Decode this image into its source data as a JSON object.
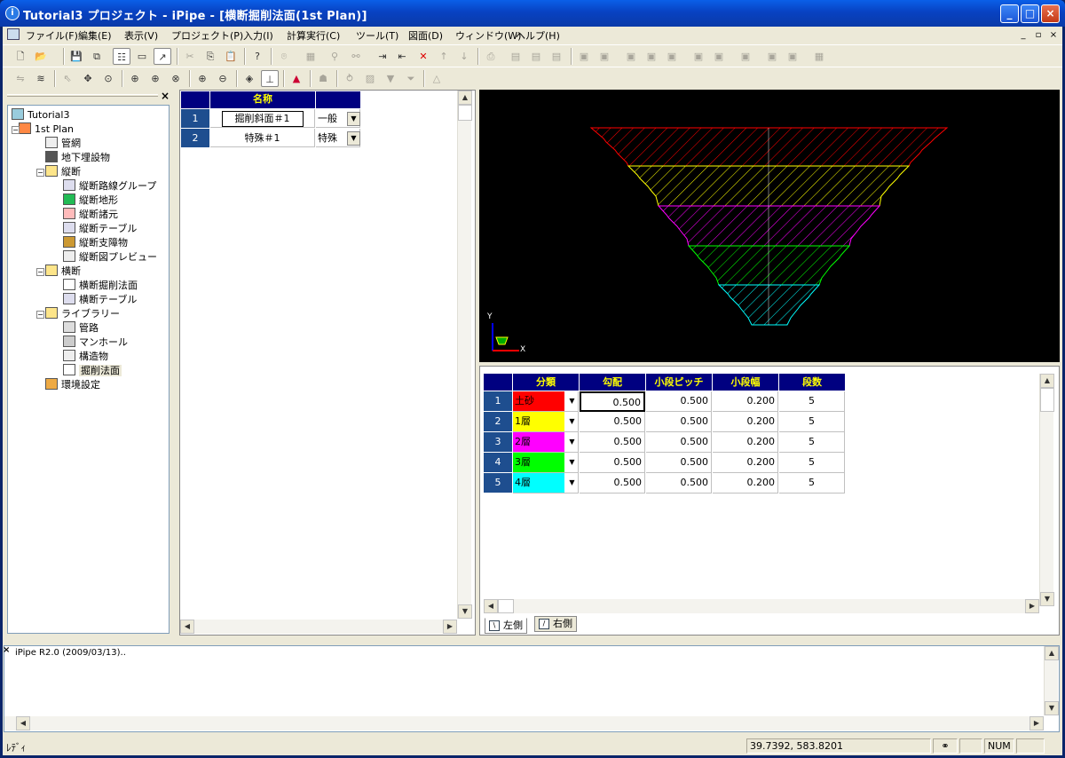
{
  "window": {
    "title": "Tutorial3 プロジェクト - iPipe - [横断掘削法面(1st Plan)]",
    "minimize": "_",
    "maximize": "□",
    "close": "×"
  },
  "menu": {
    "items": [
      "ファイル(F)",
      "編集(E)",
      "表示(V)",
      "プロジェクト(P)",
      "入力(I)",
      "計算実行(C)",
      "ツール(T)",
      "図面(D)",
      "ウィンドウ(W)",
      "ヘルプ(H)"
    ],
    "mdi_min": "_",
    "mdi_restore": "▫",
    "mdi_close": "×"
  },
  "toolbar1": [
    "new",
    "open",
    "save",
    "save-all",
    "tree",
    "frame",
    "pin",
    "cut",
    "copy",
    "paste",
    "help",
    "find",
    "delete",
    "up",
    "down"
  ],
  "tree": {
    "close": "×",
    "nodes": [
      {
        "label": "Tutorial3",
        "level": 0,
        "icon": "project-icon"
      },
      {
        "label": "1st Plan",
        "level": 1,
        "icon": "plan-icon",
        "expander": "−"
      },
      {
        "label": "管網",
        "level": 2,
        "icon": "network-icon"
      },
      {
        "label": "地下埋設物",
        "level": 2,
        "icon": "underground-icon"
      },
      {
        "label": "縦断",
        "level": 2,
        "icon": "folder-icon",
        "expander": "−"
      },
      {
        "label": "縦断路線グループ",
        "level": 3,
        "icon": "table-icon"
      },
      {
        "label": "縦断地形",
        "level": 3,
        "icon": "terrain-icon"
      },
      {
        "label": "縦断諸元",
        "level": 3,
        "icon": "spec-icon"
      },
      {
        "label": "縦断テーブル",
        "level": 3,
        "icon": "table-icon"
      },
      {
        "label": "縦断支障物",
        "level": 3,
        "icon": "obstacle-icon"
      },
      {
        "label": "縦断図プレビュー",
        "level": 3,
        "icon": "preview-icon"
      },
      {
        "label": "横断",
        "level": 2,
        "icon": "folder-icon",
        "expander": "−"
      },
      {
        "label": "横断掘削法面",
        "level": 3,
        "icon": "slope-icon"
      },
      {
        "label": "横断テーブル",
        "level": 3,
        "icon": "table-icon"
      },
      {
        "label": "ライブラリー",
        "level": 2,
        "icon": "folder-icon",
        "expander": "−"
      },
      {
        "label": "管路",
        "level": 3,
        "icon": "pipe-icon"
      },
      {
        "label": "マンホール",
        "level": 3,
        "icon": "manhole-icon"
      },
      {
        "label": "構造物",
        "level": 3,
        "icon": "structure-icon"
      },
      {
        "label": "掘削法面",
        "level": 3,
        "icon": "slope-icon",
        "selected": true
      },
      {
        "label": "環境設定",
        "level": 2,
        "icon": "settings-icon"
      }
    ]
  },
  "list": {
    "header": "名称",
    "rows": [
      {
        "no": "1",
        "name": "掘削斜面＃1",
        "type": "一般"
      },
      {
        "no": "2",
        "name": "特殊＃1",
        "type": "特殊"
      }
    ]
  },
  "canvas": {
    "axis_y": "Y",
    "axis_x": "X"
  },
  "layers": {
    "headers": [
      "分類",
      "勾配",
      "小段ピッチ",
      "小段幅",
      "段数"
    ],
    "rows": [
      {
        "no": "1",
        "name": "土砂",
        "color": "#ff0000",
        "slope": "0.500",
        "pitch": "0.500",
        "width": "0.200",
        "count": "5"
      },
      {
        "no": "2",
        "name": "1層",
        "color": "#ffff00",
        "slope": "0.500",
        "pitch": "0.500",
        "width": "0.200",
        "count": "5"
      },
      {
        "no": "3",
        "name": "2層",
        "color": "#ff00ff",
        "slope": "0.500",
        "pitch": "0.500",
        "width": "0.200",
        "count": "5"
      },
      {
        "no": "4",
        "name": "3層",
        "color": "#00ff00",
        "slope": "0.500",
        "pitch": "0.500",
        "width": "0.200",
        "count": "5"
      },
      {
        "no": "5",
        "name": "4層",
        "color": "#00ffff",
        "slope": "0.500",
        "pitch": "0.500",
        "width": "0.200",
        "count": "5"
      }
    ]
  },
  "tabs": [
    "左側",
    "右側"
  ],
  "log": {
    "close": "×",
    "text": "iPipe R2.0 (2009/03/13).."
  },
  "status": {
    "ready": "ﾚﾃﾞｨ",
    "coords": "39.7392, 583.8201",
    "num": "NUM"
  }
}
